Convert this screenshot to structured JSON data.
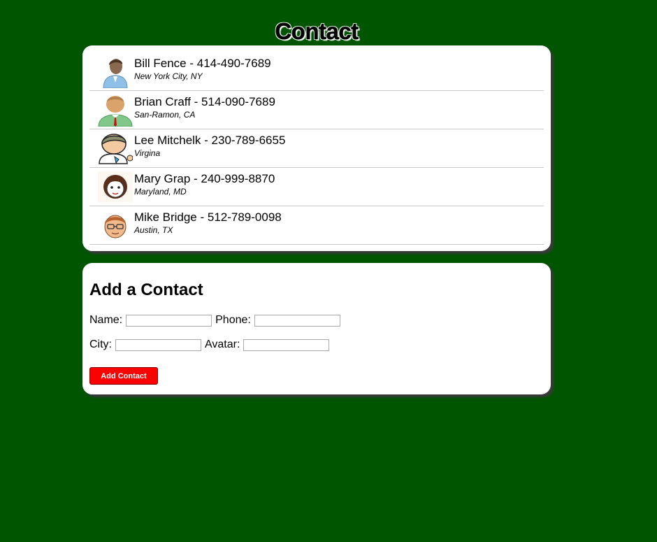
{
  "page": {
    "title": "Contact",
    "background_color": "#005500"
  },
  "contacts": [
    {
      "line": "Bill Fence - 414-490-7689",
      "city": "New York City, NY",
      "avatar_icon": "business-man-avatar-icon"
    },
    {
      "line": "Brian Craff - 514-090-7689",
      "city": "San-Ramon, CA",
      "avatar_icon": "man-with-tie-avatar-icon"
    },
    {
      "line": "Lee Mitchelk - 230-789-6655",
      "city": "Virgina",
      "avatar_icon": "cartoon-man-avatar-icon"
    },
    {
      "line": "Mary Grap - 240-999-8870",
      "city": "Maryland, MD",
      "avatar_icon": "woman-avatar-icon"
    },
    {
      "line": "Mike Bridge - 512-789-0098",
      "city": "Austin, TX",
      "avatar_icon": "man-with-glasses-avatar-icon"
    }
  ],
  "form": {
    "heading": "Add a Contact",
    "name_label": "Name:",
    "name_value": "",
    "phone_label": "Phone:",
    "phone_value": "",
    "city_label": "City:",
    "city_value": "",
    "avatar_label": "Avatar:",
    "avatar_value": "",
    "submit_label": "Add Contact",
    "submit_color": "#ff0000"
  }
}
